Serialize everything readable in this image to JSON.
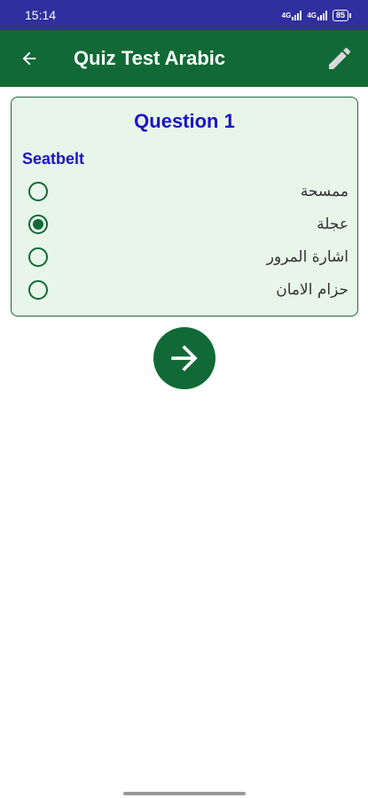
{
  "status_bar": {
    "time": "15:14",
    "signal_1": "4G",
    "signal_2": "4G",
    "battery": "85"
  },
  "app_bar": {
    "title": "Quiz Test Arabic",
    "back_icon": "arrow-left-icon",
    "edit_icon": "pencil-icon"
  },
  "question": {
    "title": "Question 1",
    "word": "Seatbelt",
    "selected_index": 1,
    "options": [
      {
        "label": "ممسحة"
      },
      {
        "label": "عجلة"
      },
      {
        "label": "اشارة المرور"
      },
      {
        "label": "حزام الامان"
      }
    ]
  },
  "next_button": {
    "icon": "arrow-right-icon"
  },
  "colors": {
    "status_bar": "#2f2f9f",
    "primary": "#116a35",
    "card_bg": "#e8f5e9",
    "question_text": "#1a14c8"
  }
}
